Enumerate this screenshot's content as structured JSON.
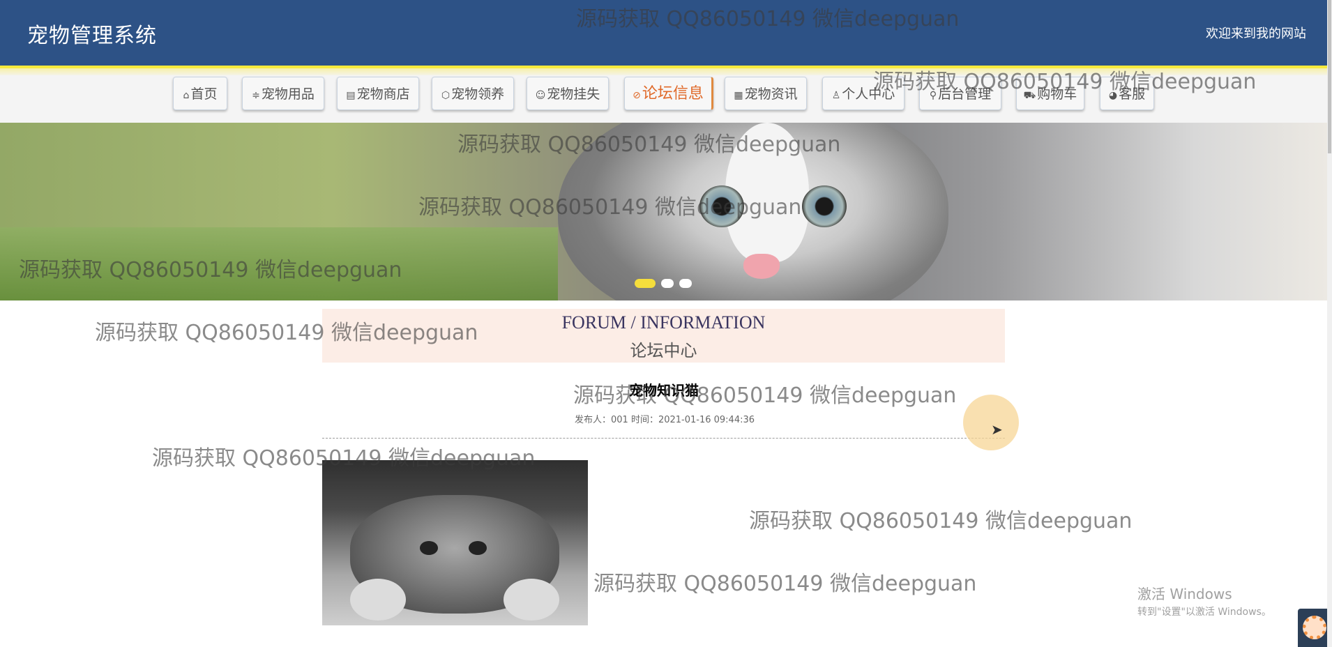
{
  "header": {
    "title": "宠物管理系统",
    "welcome": "欢迎来到我的网站"
  },
  "nav": {
    "items": [
      {
        "label": "首页",
        "icon": "home-icon",
        "glyph": "⌂"
      },
      {
        "label": "宠物用品",
        "icon": "sliders-icon",
        "glyph": "≑"
      },
      {
        "label": "宠物商店",
        "icon": "newspaper-icon",
        "glyph": "▤"
      },
      {
        "label": "宠物领养",
        "icon": "cube-icon",
        "glyph": "⬡"
      },
      {
        "label": "宠物挂失",
        "icon": "smile-icon",
        "glyph": "☺"
      },
      {
        "label": "论坛信息",
        "icon": "tag-icon",
        "glyph": "⌂",
        "active": true
      },
      {
        "label": "宠物资讯",
        "icon": "calendar-icon",
        "glyph": "▦"
      },
      {
        "label": "个人中心",
        "icon": "user-icon",
        "glyph": "♙"
      },
      {
        "label": "后台管理",
        "icon": "link-icon",
        "glyph": "⚲"
      },
      {
        "label": "购物车",
        "icon": "cart-icon",
        "glyph": "⛟"
      },
      {
        "label": "客服",
        "icon": "chat-icon",
        "glyph": "◕"
      }
    ]
  },
  "banner": {
    "slide_count": 3,
    "active_slide": 1
  },
  "forum": {
    "heading_en": "FORUM / INFORMATION",
    "heading_zh": "论坛中心"
  },
  "post": {
    "title": "宠物知识猫",
    "meta": "发布人：001 时间：2021-01-16 09:44:36"
  },
  "watermark": {
    "text": "源码获取 QQ86050149 微信deepguan"
  },
  "windows_activation": {
    "line1": "激活 Windows",
    "line2": "转到\"设置\"以激活 Windows。"
  },
  "colors": {
    "header_bg": "#2d5286",
    "header_accent": "#f7ea3d",
    "active_nav": "#e06a2a",
    "forum_heading_bg": "#fcede6"
  }
}
